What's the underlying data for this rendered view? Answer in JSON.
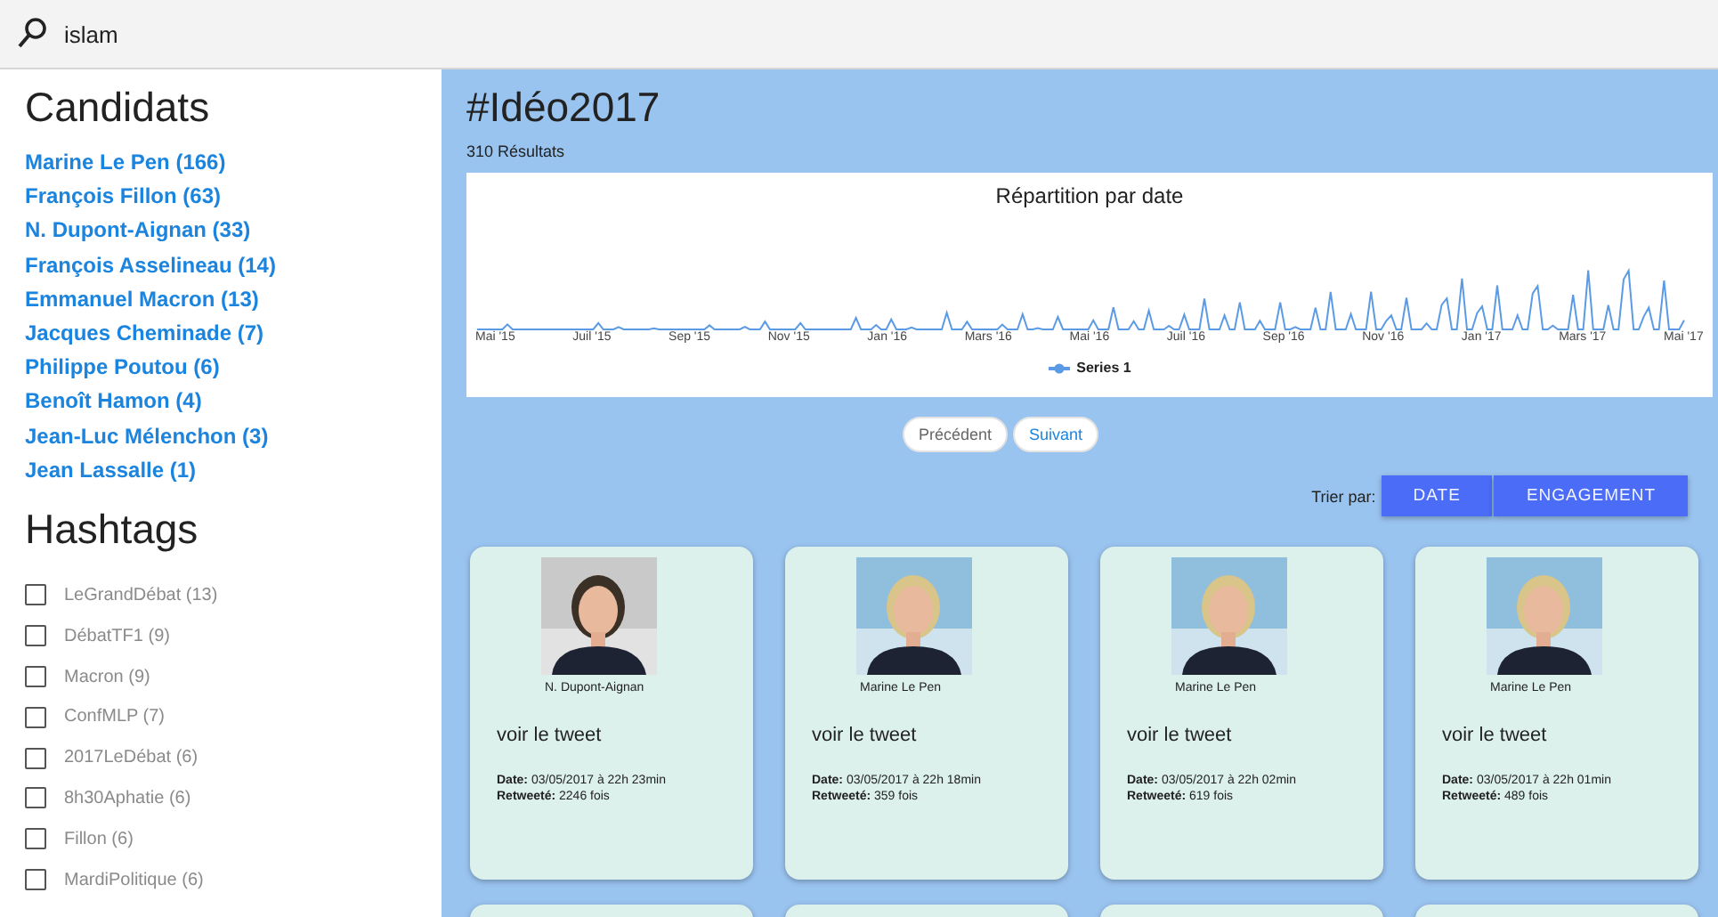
{
  "search": {
    "value": "islam"
  },
  "sidebar": {
    "candidates_title": "Candidats",
    "candidates": [
      "Marine Le Pen (166)",
      "François Fillon (63)",
      "N. Dupont-Aignan (33)",
      "François Asselineau (14)",
      "Emmanuel Macron (13)",
      "Jacques Cheminade (7)",
      "Philippe Poutou (6)",
      "Benoît Hamon (4)",
      "Jean-Luc Mélenchon (3)",
      "Jean Lassalle (1)"
    ],
    "hashtags_title": "Hashtags",
    "hashtags": [
      {
        "label": "LeGrandDébat (13)",
        "checked": false
      },
      {
        "label": "DébatTF1 (9)",
        "checked": false
      },
      {
        "label": "Macron (9)",
        "checked": false
      },
      {
        "label": "ConfMLP (7)",
        "checked": false
      },
      {
        "label": "2017LeDébat (6)",
        "checked": false
      },
      {
        "label": "8h30Aphatie (6)",
        "checked": false
      },
      {
        "label": "Fillon (6)",
        "checked": false
      },
      {
        "label": "MardiPolitique (6)",
        "checked": false
      }
    ]
  },
  "main": {
    "title": "#Idéo2017",
    "results": "310 Résultats",
    "chart": {
      "title": "Répartition par date",
      "x_labels": [
        "Mai '15",
        "Juil '15",
        "Sep '15",
        "Nov '15",
        "Jan '16",
        "Mars '16",
        "Mai '16",
        "Juil '16",
        "Sep '16",
        "Nov '16",
        "Jan '17",
        "Mars '17",
        "Mai '17"
      ],
      "legend": "Series 1"
    },
    "pagination": [
      {
        "label": "Précédent",
        "disabled": true
      },
      {
        "label": "Suivant",
        "disabled": false
      }
    ],
    "sort_label": "Trier par:",
    "sort_buttons": [
      "DATE",
      "ENGAGEMENT"
    ],
    "cards": [
      {
        "author": "N. Dupont-Aignan",
        "link": "voir le tweet",
        "date": "**Date:** 03/05/2017 à 22h 23min",
        "retweets": "**Retweeté:** 2246 fois"
      },
      {
        "author": "Marine Le Pen",
        "link": "voir le tweet",
        "date": "**Date:** 03/05/2017 à 22h 18min",
        "retweets": "**Retweeté:** 359 fois"
      },
      {
        "author": "Marine Le Pen",
        "link": "voir le tweet",
        "date": "**Date:** 03/05/2017 à 22h 02min",
        "retweets": "**Retweeté:** 619 fois"
      },
      {
        "author": "Marine Le Pen",
        "link": "voir le tweet",
        "date": "**Date:** 03/05/2017 à 22h 01min",
        "retweets": "**Retweeté:** 489 fois"
      }
    ]
  }
}
